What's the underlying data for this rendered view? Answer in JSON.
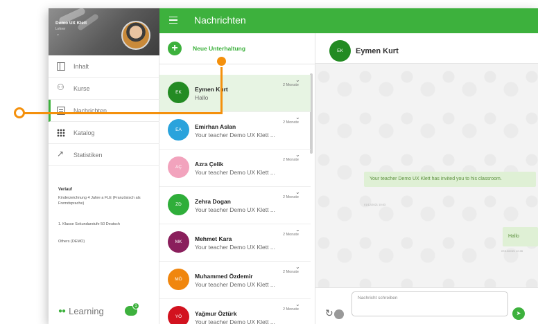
{
  "sidebar": {
    "profile_name": "Demo UX Klett",
    "profile_role": "Lehrer",
    "nav": [
      "Inhalt",
      "Kurse",
      "Nachrichten",
      "Katalog",
      "Statistiken"
    ],
    "verlauf_title": "Verlauf",
    "verlauf": [
      "Kinderzeichnung 4 Jahre a FLE (Französisch als Fremdsprache)",
      "1. Klasse Sekundarstufe 50 Deutsch",
      "Others (DEMO)"
    ],
    "brand": "Learning",
    "chat_badge": "1"
  },
  "topbar": {
    "title": "Nachrichten"
  },
  "conversations": {
    "new_label": "Neue Unterhaltung",
    "items": [
      {
        "initials": "EK",
        "name": "Eymen Kurt",
        "message": "Hallo",
        "time": "2 Monate",
        "color": "#238b23"
      },
      {
        "initials": "EA",
        "name": "Emirhan Aslan",
        "message": "Your teacher Demo UX Klett ...",
        "time": "2 Monate",
        "color": "#2aa3dc"
      },
      {
        "initials": "AÇ",
        "name": "Azra Çelik",
        "message": "Your teacher Demo UX Klett ...",
        "time": "2 Monate",
        "color": "#f2a3bd"
      },
      {
        "initials": "ZD",
        "name": "Zehra Dogan",
        "message": "Your teacher Demo UX Klett ...",
        "time": "2 Monate",
        "color": "#2fae3a"
      },
      {
        "initials": "MK",
        "name": "Mehmet Kara",
        "message": "Your teacher Demo UX Klett ...",
        "time": "2 Monate",
        "color": "#8a1f5c"
      },
      {
        "initials": "MÖ",
        "name": "Muhammed Özdemir",
        "message": "Your teacher Demo UX Klett ...",
        "time": "2 Monate",
        "color": "#f0860e"
      },
      {
        "initials": "YÖ",
        "name": "Yağmur Öztürk",
        "message": "Your teacher Demo UX Klett ...",
        "time": "2 Monate",
        "color": "#d2121f"
      }
    ]
  },
  "chat": {
    "header_initials": "EK",
    "header_name": "Eymen Kurt",
    "invite_message": "Your teacher Demo UX Klett has invited you to his classroom.",
    "invite_time": "01/12/2021 10:03",
    "reply_message": "Hallo",
    "reply_time": "07/12/2021 10:35",
    "input_placeholder": "Nachricht schreiben"
  },
  "colors": {
    "accent": "#3db13d",
    "annotation": "#f4900c",
    "bubble": "#dff0d5"
  }
}
